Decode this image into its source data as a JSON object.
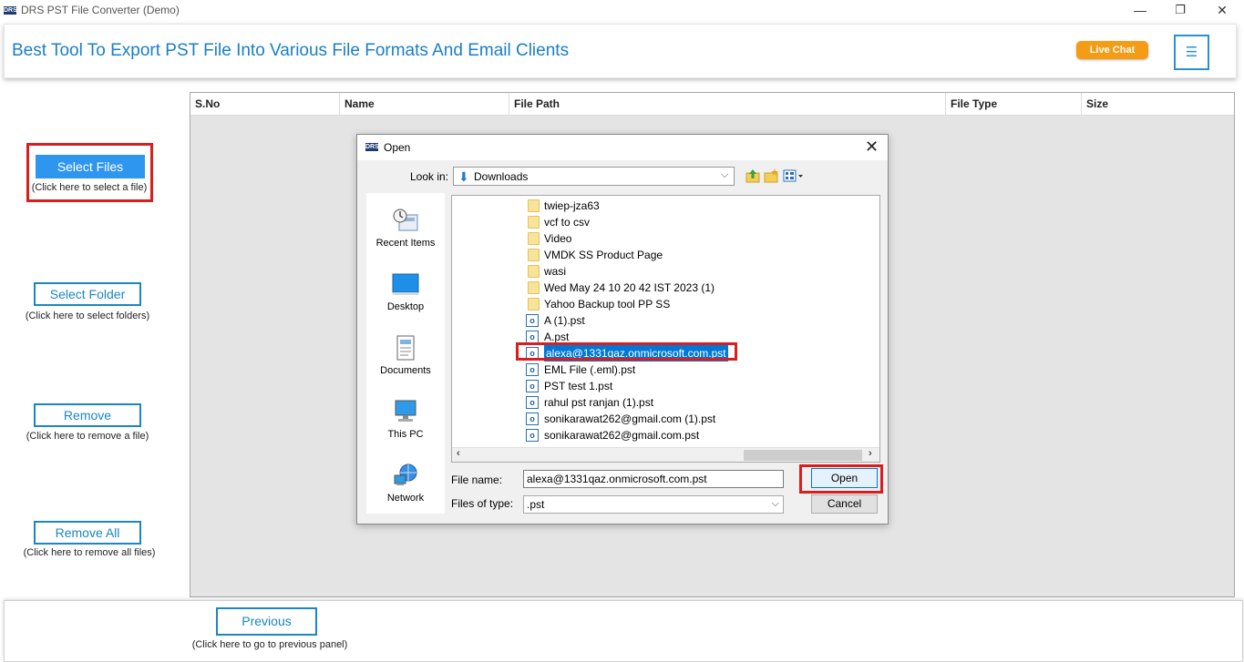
{
  "window": {
    "logo_text": "DRS",
    "title": "DRS PST File Converter (Demo)",
    "min_glyph": "—",
    "max_glyph": "❐",
    "close_glyph": "✕"
  },
  "header": {
    "title": "Best Tool To Export PST File Into Various File Formats And Email Clients",
    "live_chat": "Live Chat",
    "menu_glyph": "☰"
  },
  "sidebar": {
    "select_files": "Select Files",
    "select_files_hint": "(Click here to select a file)",
    "select_folder": "Select Folder",
    "select_folder_hint": "(Click here to select folders)",
    "remove": "Remove",
    "remove_hint": "(Click here to remove a file)",
    "remove_all": "Remove All",
    "remove_all_hint": "(Click here to remove all files)"
  },
  "table": {
    "columns": [
      "S.No",
      "Name",
      "File Path",
      "File Type",
      "Size"
    ]
  },
  "dialog": {
    "logo_text": "DRS",
    "title": "Open",
    "close_glyph": "✕",
    "look_in_label": "Look in:",
    "look_in_value": "Downloads",
    "places": [
      {
        "label": "Recent Items",
        "icon": "recent-items-icon"
      },
      {
        "label": "Desktop",
        "icon": "desktop-icon"
      },
      {
        "label": "Documents",
        "icon": "documents-icon"
      },
      {
        "label": "This PC",
        "icon": "this-pc-icon"
      },
      {
        "label": "Network",
        "icon": "network-icon"
      }
    ],
    "files": [
      {
        "name": "twiep-jza63",
        "type": "folder"
      },
      {
        "name": "vcf to csv",
        "type": "folder"
      },
      {
        "name": "Video",
        "type": "folder"
      },
      {
        "name": "VMDK SS Product Page",
        "type": "folder"
      },
      {
        "name": "wasi",
        "type": "folder"
      },
      {
        "name": "Wed May 24 10 20 42 IST 2023 (1)",
        "type": "folder"
      },
      {
        "name": "Yahoo Backup tool PP SS",
        "type": "folder"
      },
      {
        "name": "A (1).pst",
        "type": "pst"
      },
      {
        "name": "A.pst",
        "type": "pst"
      },
      {
        "name": "alexa@1331qaz.onmicrosoft.com.pst",
        "type": "pst",
        "selected": true
      },
      {
        "name": "EML File (.eml).pst",
        "type": "pst"
      },
      {
        "name": "PST test 1.pst",
        "type": "pst"
      },
      {
        "name": "rahul pst ranjan (1).pst",
        "type": "pst"
      },
      {
        "name": "sonikarawat262@gmail.com (1).pst",
        "type": "pst"
      },
      {
        "name": "sonikarawat262@gmail.com.pst",
        "type": "pst"
      }
    ],
    "file_name_label": "File name:",
    "file_name_value": "alexa@1331qaz.onmicrosoft.com.pst",
    "files_of_type_label": "Files of type:",
    "files_of_type_value": ".pst",
    "open_button": "Open",
    "cancel_button": "Cancel"
  },
  "footer": {
    "previous": "Previous",
    "previous_hint": "(Click here to go to previous panel)"
  },
  "colors": {
    "accent_blue": "#1a86c6",
    "live_chat_orange": "#f59c15",
    "highlight_red": "#d81e1e",
    "selection_blue": "#0078d7"
  }
}
